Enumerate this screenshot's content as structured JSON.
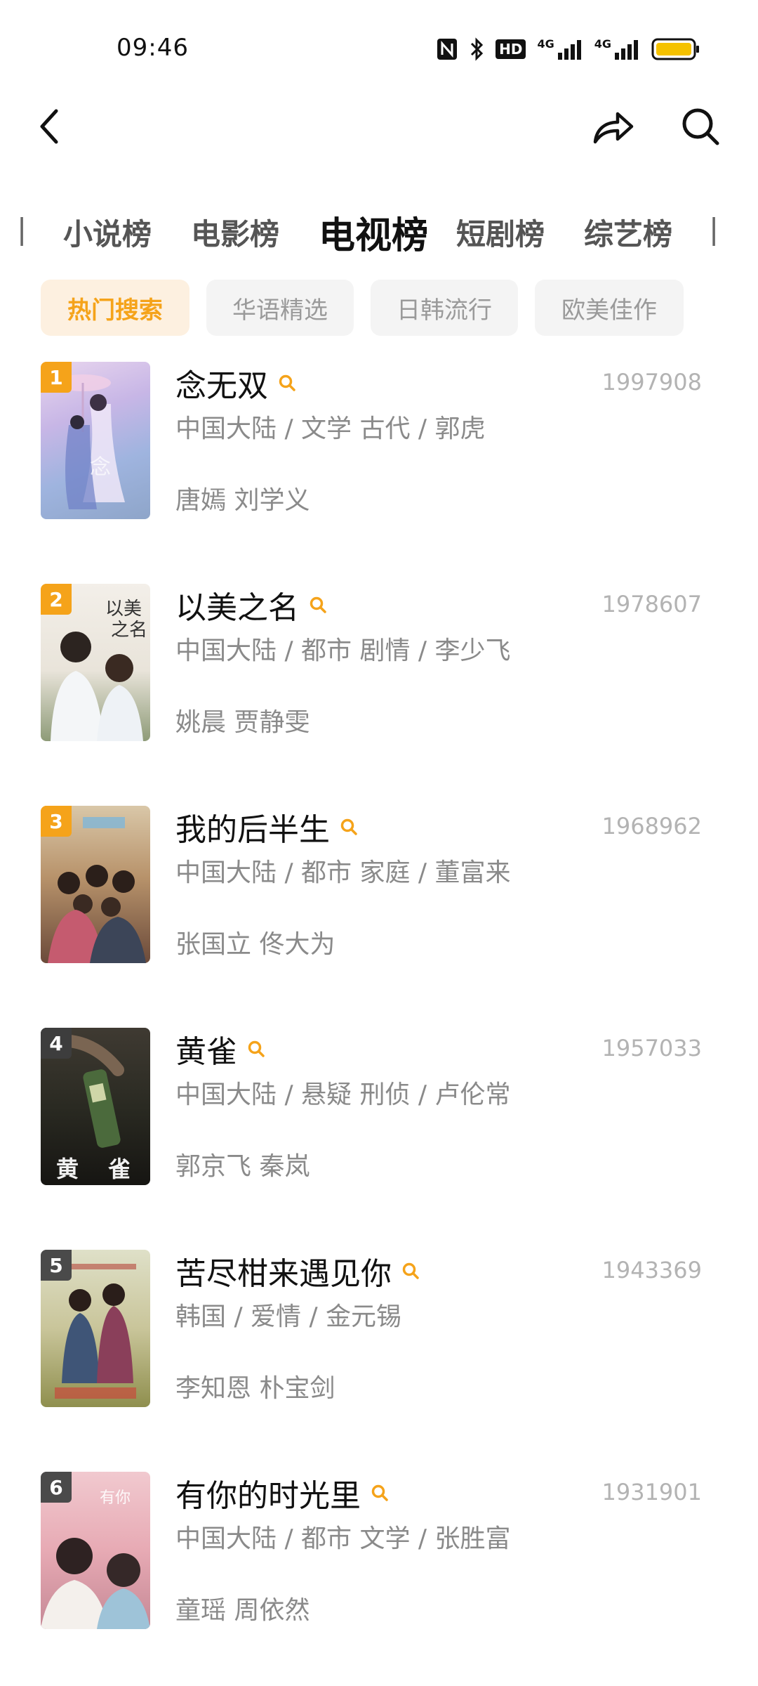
{
  "status_bar": {
    "time": "09:46",
    "network_labels": [
      "4G",
      "4G"
    ],
    "hd_label": "HD"
  },
  "nav": {
    "back_icon": "chevron-left-icon",
    "share_icon": "share-arrow-icon",
    "search_icon": "search-icon"
  },
  "tabs": [
    {
      "label": "小说榜",
      "active": false
    },
    {
      "label": "电影榜",
      "active": false
    },
    {
      "label": "电视榜",
      "active": true
    },
    {
      "label": "短剧榜",
      "active": false
    },
    {
      "label": "综艺榜",
      "active": false
    }
  ],
  "chips": [
    {
      "label": "热门搜索",
      "active": true
    },
    {
      "label": "华语精选",
      "active": false
    },
    {
      "label": "日韩流行",
      "active": false
    },
    {
      "label": "欧美佳作",
      "active": false
    }
  ],
  "accent_color": "#f5a31a",
  "items": [
    {
      "rank": "1",
      "title": "念无双",
      "meta": "中国大陆 / 文学 古代 / 郭虎",
      "cast": "唐嫣 刘学义",
      "score": "1997908",
      "rank_color": "#f5a31a"
    },
    {
      "rank": "2",
      "title": "以美之名",
      "meta": "中国大陆 / 都市 剧情 / 李少飞",
      "cast": "姚晨 贾静雯",
      "score": "1978607",
      "rank_color": "#f5a31a"
    },
    {
      "rank": "3",
      "title": "我的后半生",
      "meta": "中国大陆 / 都市 家庭 / 董富来",
      "cast": "张国立 佟大为",
      "score": "1968962",
      "rank_color": "#f5a31a"
    },
    {
      "rank": "4",
      "title": "黄雀",
      "meta": "中国大陆 / 悬疑 刑侦 / 卢伦常",
      "cast": "郭京飞 秦岚",
      "score": "1957033",
      "rank_color": "#3d3d3d"
    },
    {
      "rank": "5",
      "title": "苦尽柑来遇见你",
      "meta": "韩国 / 爱情 / 金元锡",
      "cast": "李知恩 朴宝剑",
      "score": "1943369",
      "rank_color": "#4a4a4a"
    },
    {
      "rank": "6",
      "title": "有你的时光里",
      "meta": "中国大陆 / 都市 文学 / 张胜富",
      "cast": "童瑶 周依然",
      "score": "1931901",
      "rank_color": "#4a4a4a"
    }
  ]
}
